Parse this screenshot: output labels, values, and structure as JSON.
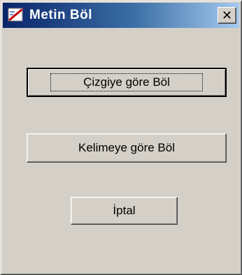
{
  "window": {
    "title": "Metin Böl",
    "close_label": "✕"
  },
  "buttons": {
    "split_by_line": "Çizgiye göre Böl",
    "split_by_word": "Kelimeye göre Böl",
    "cancel": "İptal"
  },
  "icons": {
    "app": "pencil-document-icon",
    "close": "close-icon"
  },
  "colors": {
    "face": "#d4d0c8",
    "title_start": "#0a246a",
    "title_end": "#a6caf0"
  }
}
